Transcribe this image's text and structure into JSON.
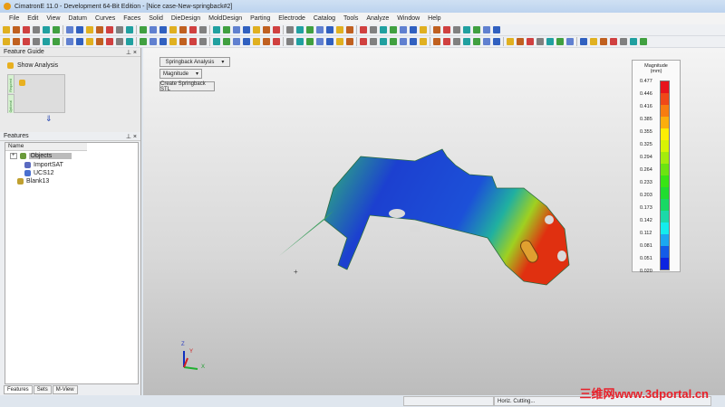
{
  "window": {
    "title": "CimatronE 11.0 - Development 64-Bit Edition - [Nice case-New-springback#2]"
  },
  "menu": [
    "File",
    "Edit",
    "View",
    "Datum",
    "Curves",
    "Faces",
    "Solid",
    "DieDesign",
    "MoldDesign",
    "Parting",
    "Electrode",
    "Catalog",
    "Tools",
    "Analyze",
    "Window",
    "Help"
  ],
  "feature_guide": {
    "title": "Feature Guide",
    "show_analysis": "Show Analysis",
    "required": "Required",
    "optional": "Optional"
  },
  "features": {
    "title": "Features",
    "column": "Name",
    "nodes": [
      "Objects",
      "ImportSAT",
      "UCS12",
      "Blank13"
    ]
  },
  "bottom_tabs": [
    "Features",
    "Sets",
    "M-View"
  ],
  "viewport": {
    "analysis_dropdown": "Springback Analysis",
    "magnitude_dropdown": "Magnitude",
    "create_button": "Create Springback STL",
    "axes": {
      "x": "X",
      "y": "Y",
      "z": "Z"
    }
  },
  "legend": {
    "title": "Magnitude",
    "unit": "(mm)",
    "values": [
      "0.477",
      "0.446",
      "0.416",
      "0.385",
      "0.355",
      "0.325",
      "0.294",
      "0.264",
      "0.233",
      "0.203",
      "0.173",
      "0.142",
      "0.112",
      "0.081",
      "0.051",
      "0.020"
    ],
    "colors": [
      "#e8141c",
      "#f04818",
      "#f87c10",
      "#fcae0c",
      "#fcee04",
      "#d8f404",
      "#a4ec0c",
      "#6ce410",
      "#38e414",
      "#20dc30",
      "#18d864",
      "#1cd8a8",
      "#14ecec",
      "#1ca8f0",
      "#145ce8",
      "#0c24e0"
    ]
  },
  "status": {
    "mode": "Horiz. Cutting..."
  },
  "watermark": "三维网www.3dportal.cn"
}
